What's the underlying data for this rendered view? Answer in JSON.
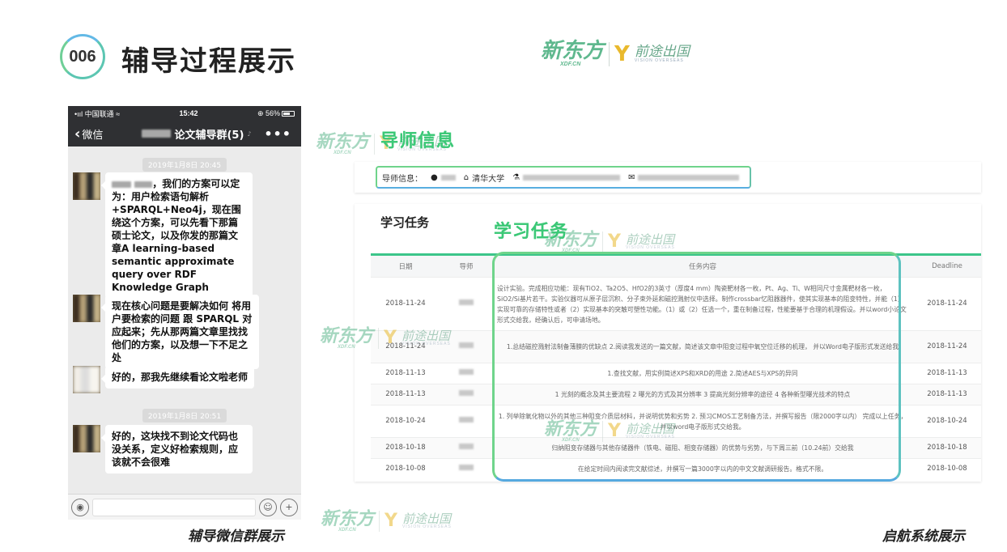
{
  "slide": {
    "number": "006",
    "title": "辅导过程展示"
  },
  "brand": {
    "name": "新东方",
    "sub": "XDF.CN",
    "vision": "前途出国",
    "vision_sub": "VISION OVERSEAS"
  },
  "phone": {
    "status": {
      "carrier": "•ııl 中国联通 ≈",
      "time": "15:42",
      "battery": "⊕ 56%"
    },
    "nav": {
      "back": "微信",
      "title": "论文辅导群(5)",
      "more": "•••"
    },
    "timestamps": [
      "2019年1月8日 20:45",
      "2019年1月8日 20:51"
    ],
    "messages": [
      {
        "text": "，我们的方案可以定为：用户检索语句解析 +SPARQL+Neo4j，现在围绕这个方案，可以先看下那篇硕士论文，以及你发的那篇文章A learning-based semantic approximate query over RDF Knowledge Graph"
      },
      {
        "text": "现在核心问题是要解决如何 将用户要检索的问题 跟 SPARQL 对应起来；先从那两篇文章里找找他们的方案，以及想一下不足之处"
      },
      {
        "text": "好的，那我先继续看论文啦老师"
      },
      {
        "text": "好的，这块找不到论文代码也没关系，定义好检索规则，应该就不会很难"
      }
    ]
  },
  "captions": {
    "left": "辅导微信群展示",
    "right": "启航系统展示"
  },
  "labels": {
    "mentor_info": "导师信息",
    "tasks": "学习任务"
  },
  "mentor": {
    "prefix": "导师信息：",
    "school": "清华大学"
  },
  "tasks": {
    "title": "学习任务",
    "headers": [
      "日期",
      "导师",
      "任务内容",
      "Deadline"
    ],
    "rows": [
      {
        "date": "2018-11-24",
        "content": "设计实验。完成相应功能：现有TiO2、Ta2O5、HfO2的3英寸（厚度4 mm）陶瓷靶材各一枚，Pt、Ag、Ti、W相同尺寸金属靶材各一枚，SiO2/Si基片若干。实验仪器可从原子层沉积、分子束外延和磁控溅射仪中选择。制作crossbar忆阻器器件，使其实现基本的阻变特性，并能（1）实现可靠的存储特性或者（2）实现基本的突触可塑性功能。（1）或（2）任选一个，重在制备过程，性能要基于合理的机理假设。并以word小论文形式交给我，经确认后，可申请场地。",
        "deadline": "2018-11-24"
      },
      {
        "date": "2018-11-24",
        "content": "1.总结磁控溅射法制备薄膜的优缺点 2.阅读我发送的一篇文献，简述该文章中阻变过程中氧空位迁移的机理， 并以Word电子版形式发送给我",
        "deadline": "2018-11-24"
      },
      {
        "date": "2018-11-13",
        "content": "1.查找文献，用实例简述XPS和XRD的用途 2.简述AES与XPS的异同",
        "deadline": "2018-11-13"
      },
      {
        "date": "2018-11-13",
        "content": "1 光刻的概念及其主要流程 2 曝光的方式及其分辨率 3 提高光刻分辨率的途径 4 各种新型曝光技术的特点",
        "deadline": "2018-11-13"
      },
      {
        "date": "2018-10-24",
        "content": "1. 列举除氧化物以外的其他三种阻变介质层材料，并说明优势和劣势 2. 预习CMOS工艺制备方法，并撰写报告（限2000字以内） 完成以上任务，并以word电子版形式交给我。",
        "deadline": "2018-10-24"
      },
      {
        "date": "2018-10-18",
        "content": "归纳阻变存储器与其他存储器件（铁电、磁阻、相变存储器）的优势与劣势，与下周三前（10.24前）交给我",
        "deadline": "2018-10-18"
      },
      {
        "date": "2018-10-08",
        "content": "在给定时间内阅读完文献综述，并撰写一篇3000字以内的中文文献调研报告。格式不限。",
        "deadline": "2018-10-08"
      }
    ]
  }
}
